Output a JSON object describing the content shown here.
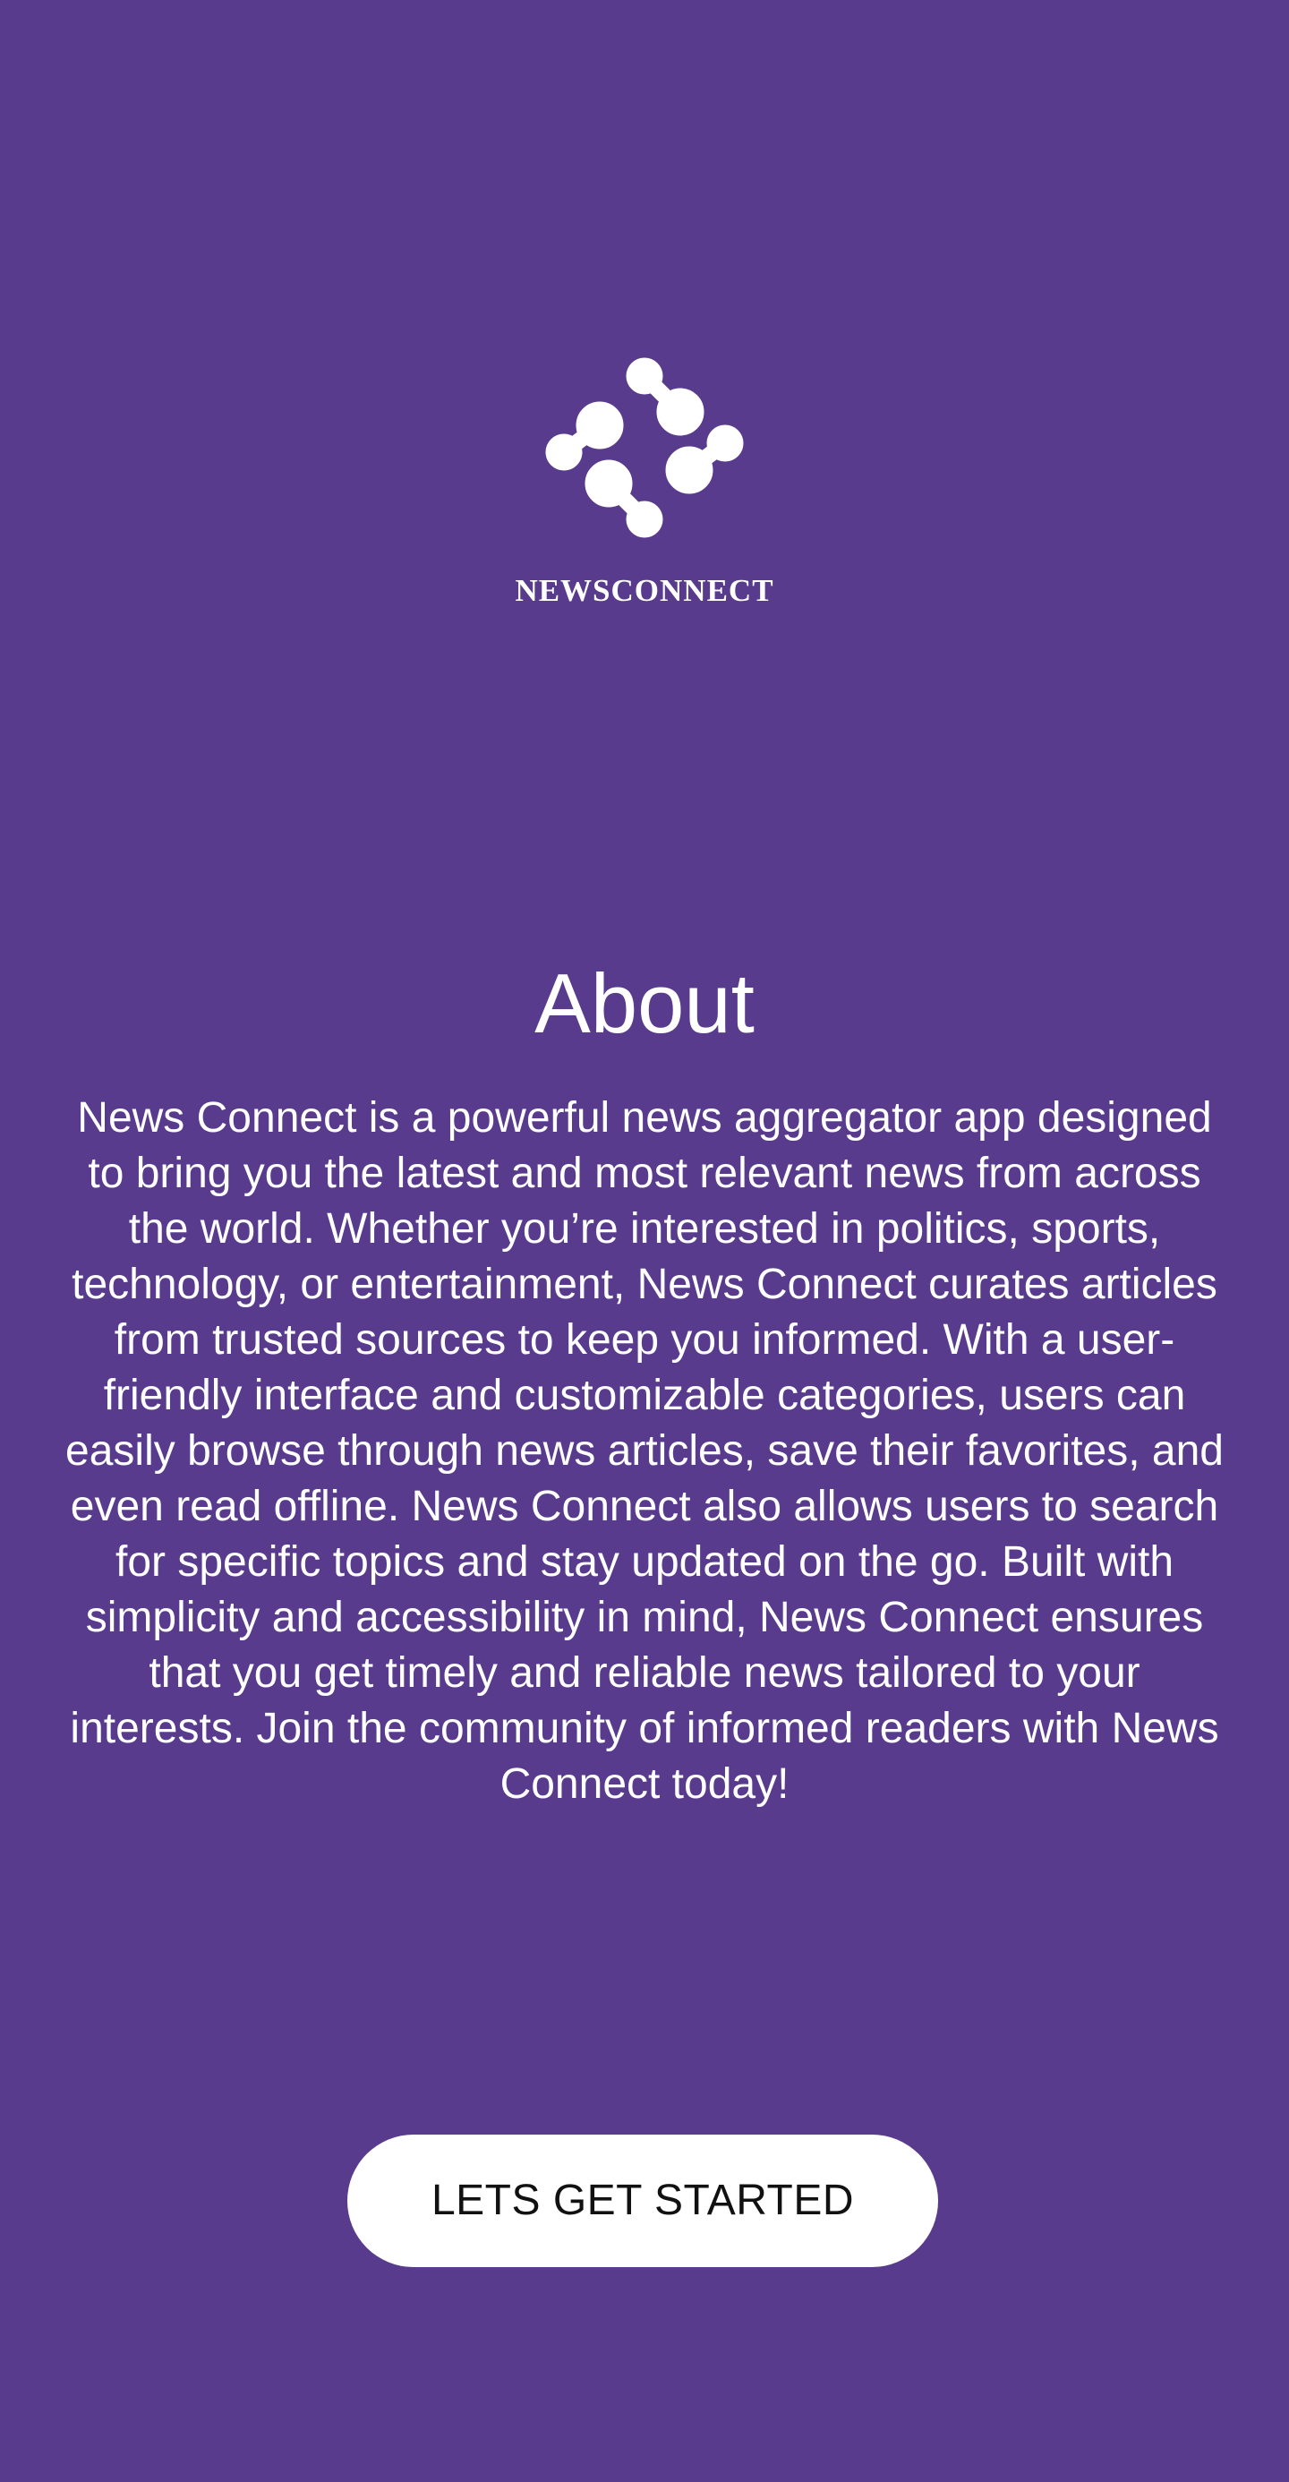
{
  "app": {
    "brand_name": "NEWSCONNECT",
    "logo_icon": "newsconnect-logo-icon"
  },
  "about": {
    "title": "About",
    "description": "News Connect is a powerful news aggregator app designed to bring you the latest and most relevant news from across the world. Whether you’re interested in politics, sports, technology, or entertainment, News Connect curates articles from trusted sources to keep you informed. With a user-friendly interface and customizable categories, users can easily browse through news articles, save their favorites, and even read offline. News Connect also allows users to search for specific topics and stay updated on the go. Built with simplicity and accessibility in mind, News Connect ensures that you get timely and reliable news tailored to your interests. Join the community of informed readers with News Connect today!"
  },
  "cta": {
    "label": "LETS GET STARTED"
  },
  "colors": {
    "background": "#583b8c",
    "text": "#ffffff",
    "button_background": "#ffffff",
    "button_text": "#111111"
  }
}
